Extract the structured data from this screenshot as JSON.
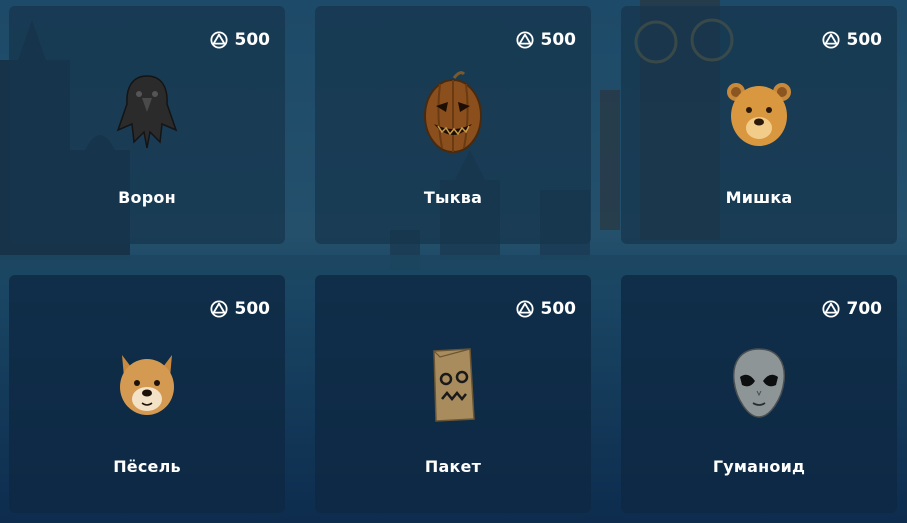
{
  "currency": {
    "icon": "coin-icon",
    "color": "#ffffff"
  },
  "items": [
    {
      "name": "Ворон",
      "price": "500",
      "icon": "crow-mask-icon"
    },
    {
      "name": "Тыква",
      "price": "500",
      "icon": "pumpkin-mask-icon"
    },
    {
      "name": "Мишка",
      "price": "500",
      "icon": "bear-mask-icon"
    },
    {
      "name": "Пёсель",
      "price": "500",
      "icon": "dog-mask-icon"
    },
    {
      "name": "Пакет",
      "price": "500",
      "icon": "paper-bag-mask-icon"
    },
    {
      "name": "Гуманоид",
      "price": "700",
      "icon": "alien-mask-icon"
    }
  ]
}
